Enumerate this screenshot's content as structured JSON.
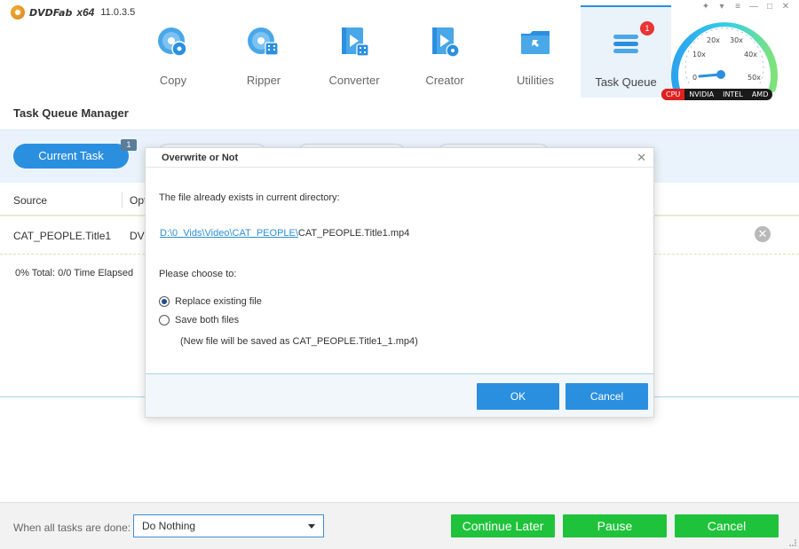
{
  "app": {
    "name": "DVDFab",
    "arch": "x64",
    "version": "11.0.3.5"
  },
  "nav": [
    {
      "label": "Copy",
      "icon": "copy-disc-icon"
    },
    {
      "label": "Ripper",
      "icon": "ripper-icon"
    },
    {
      "label": "Converter",
      "icon": "converter-icon"
    },
    {
      "label": "Creator",
      "icon": "creator-icon"
    },
    {
      "label": "Utilities",
      "icon": "utilities-icon"
    },
    {
      "label": "Task Queue",
      "icon": "task-queue-icon",
      "badge": "1",
      "active": true
    }
  ],
  "gauge": {
    "ticks": [
      "0",
      "10x",
      "20x",
      "30x",
      "40x",
      "50x"
    ],
    "hardware": [
      "CPU",
      "NVIDIA",
      "INTEL",
      "AMD"
    ]
  },
  "page_title": "Task Queue Manager",
  "tabs": {
    "current": "Current Task",
    "current_count": "1"
  },
  "table": {
    "headers": [
      "Source",
      "Opt"
    ],
    "row": {
      "source": "CAT_PEOPLE.Title1",
      "output": "DVI"
    },
    "progress": "0%   Total: 0/0  Time Elapsed"
  },
  "footer": {
    "label": "When all tasks are done:",
    "select_value": "Do Nothing",
    "continue_later": "Continue Later",
    "pause": "Pause",
    "cancel": "Cancel"
  },
  "dialog": {
    "title": "Overwrite or Not",
    "message": "The file already exists in current directory:",
    "path_link": "D:\\0_Vids\\Video\\CAT_PEOPLE\\",
    "filename": "CAT_PEOPLE.Title1.mp4",
    "prompt": "Please choose to:",
    "options": [
      {
        "label": "Replace existing file",
        "checked": true
      },
      {
        "label": "Save both files",
        "checked": false
      }
    ],
    "note": "(New file will be saved as CAT_PEOPLE.Title1_1.mp4)",
    "ok": "OK",
    "cancel": "Cancel"
  },
  "colors": {
    "accent": "#2b8fe0",
    "green": "#1fc33b",
    "badge_red": "#ea3434"
  }
}
